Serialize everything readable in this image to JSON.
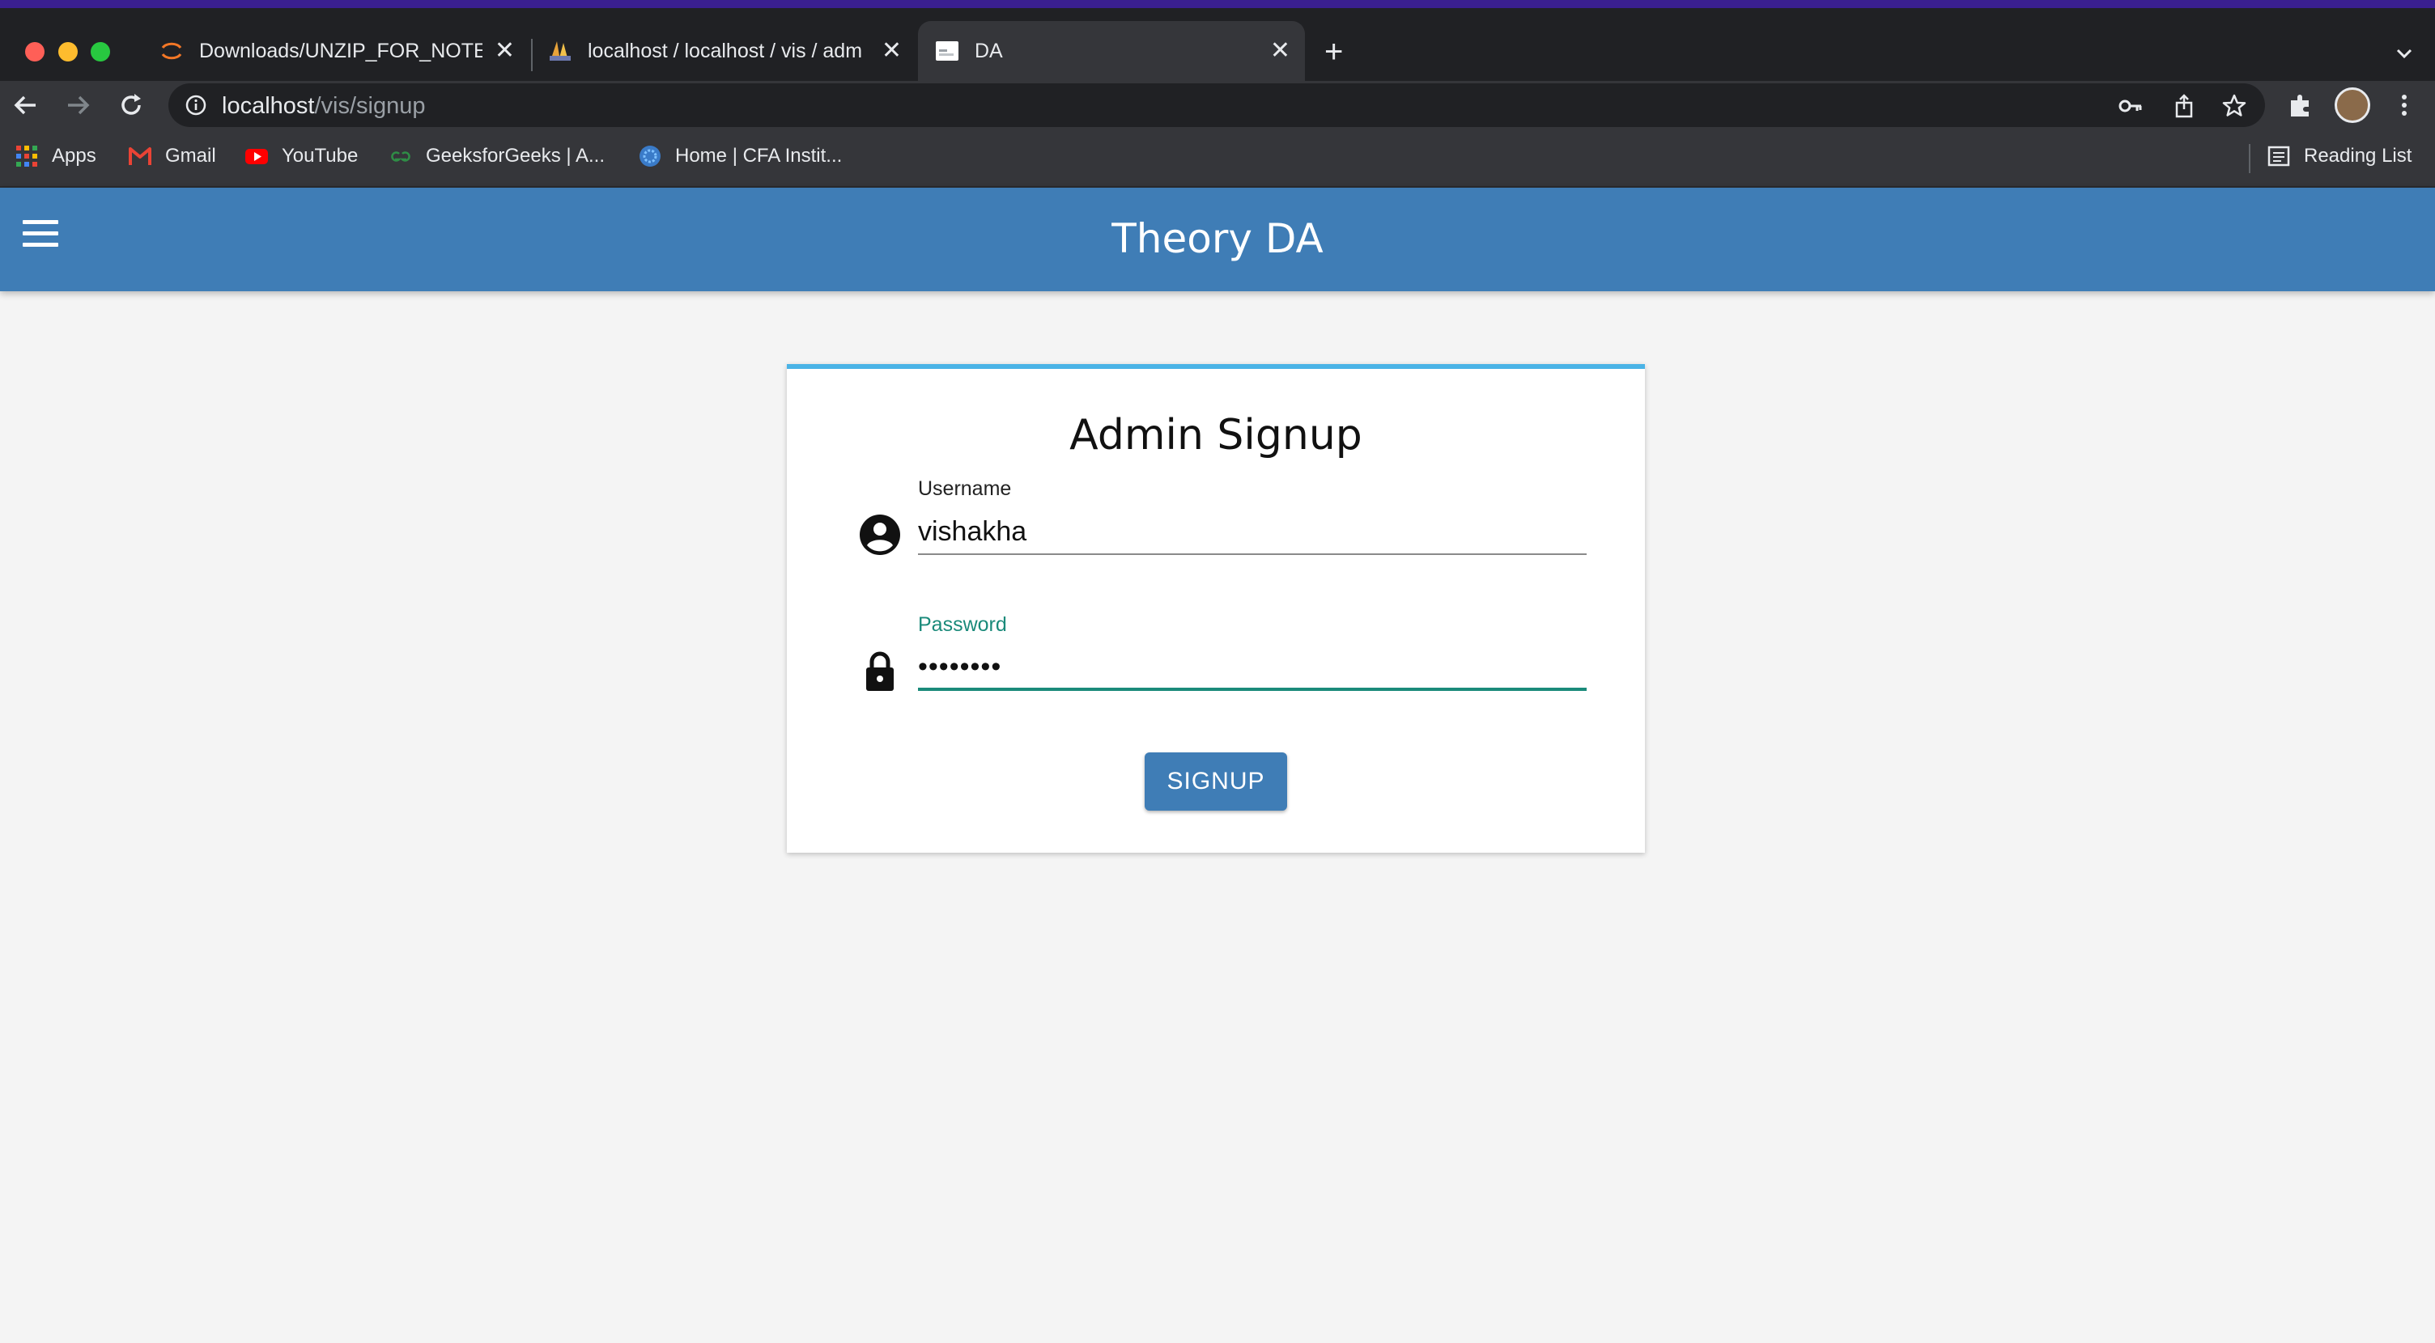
{
  "browser": {
    "tabs": [
      {
        "title": "Downloads/UNZIP_FOR_NOTE",
        "icon": "jupyter-icon",
        "close": "✕"
      },
      {
        "title": "localhost / localhost / vis / adm",
        "icon": "phpmyadmin-icon",
        "close": "✕"
      },
      {
        "title": "DA",
        "icon": "page-icon",
        "close": "✕",
        "active": true
      }
    ],
    "new_tab": "+",
    "address": {
      "host": "localhost",
      "path": "/vis/signup"
    },
    "bookmarks": [
      {
        "label": "Apps",
        "icon": "apps-grid-icon"
      },
      {
        "label": "Gmail",
        "icon": "gmail-icon"
      },
      {
        "label": "YouTube",
        "icon": "youtube-icon"
      },
      {
        "label": "GeeksforGeeks | A...",
        "icon": "geeksforgeeks-icon"
      },
      {
        "label": "Home | CFA Instit...",
        "icon": "cfa-icon"
      }
    ],
    "reading_list": "Reading List"
  },
  "app": {
    "title": "Theory DA",
    "accent": "#3f7db6"
  },
  "form": {
    "title": "Admin Signup",
    "username_label": "Username",
    "username_value": "vishakha",
    "password_label": "Password",
    "password_value": "••••••••",
    "submit_label": "SIGNUP"
  }
}
